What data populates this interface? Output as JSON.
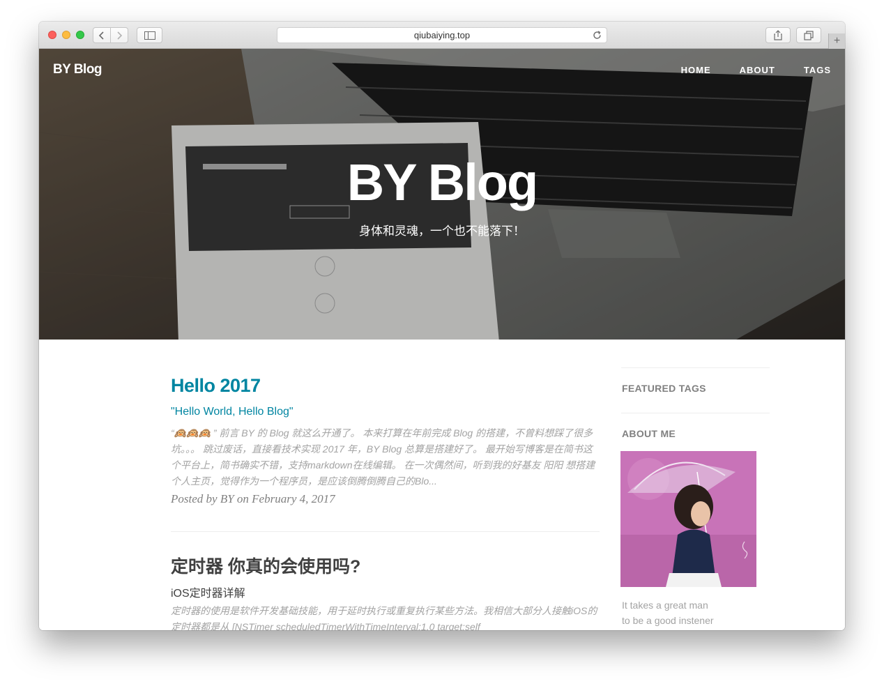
{
  "browser": {
    "url": "qiubaiying.top",
    "buttons": {
      "back_icon": "chevron-left-icon",
      "forward_icon": "chevron-right-icon",
      "sidebar_icon": "sidebar-icon",
      "share_icon": "share-icon",
      "tabs_icon": "tabs-icon",
      "new_tab_icon": "plus-icon",
      "reload_icon": "reload-icon"
    }
  },
  "nav": {
    "brand": "BY Blog",
    "links": [
      "HOME",
      "ABOUT",
      "TAGS"
    ]
  },
  "hero": {
    "title": "BY Blog",
    "subtitle": "身体和灵魂，一个也不能落下！"
  },
  "posts": [
    {
      "title": "Hello 2017",
      "subtitle": "\"Hello World, Hello Blog\"",
      "excerpt": "“🙉🙉🙉 ” 前言 BY 的 Blog 就这么开通了。 本来打算在年前完成 Blog 的搭建，不曾料想踩了很多坑。。。 跳过废话，直接看技术实现 2017 年，BY Blog 总算是搭建好了。 最开始写博客是在简书这个平台上，简书确实不错，支持markdown在线编辑。 在一次偶然间，听到我的好基友 阳阳 想搭建个人主页，觉得作为一个程序员，是应该倒腾倒腾自己的Blo...",
      "meta": "Posted by BY on February 4, 2017"
    },
    {
      "title": "定时器 你真的会使用吗?",
      "subtitle": "iOS定时器详解",
      "excerpt": "定时器的使用是软件开发基础技能，用于延时执行或重复执行某些方法。我相信大部分人接触iOS的定时器都是从 [NSTimer scheduledTimerWithTimeInterval:1.0 target:self"
    }
  ],
  "sidebar": {
    "featured_tags": "FEATURED TAGS",
    "about_me": "ABOUT ME",
    "bio_line1": "It takes a great man",
    "bio_line2": "to be a good instener"
  },
  "colors": {
    "accent": "#0085a1",
    "text_dark": "#404040",
    "text_muted": "#a3a3a3"
  }
}
